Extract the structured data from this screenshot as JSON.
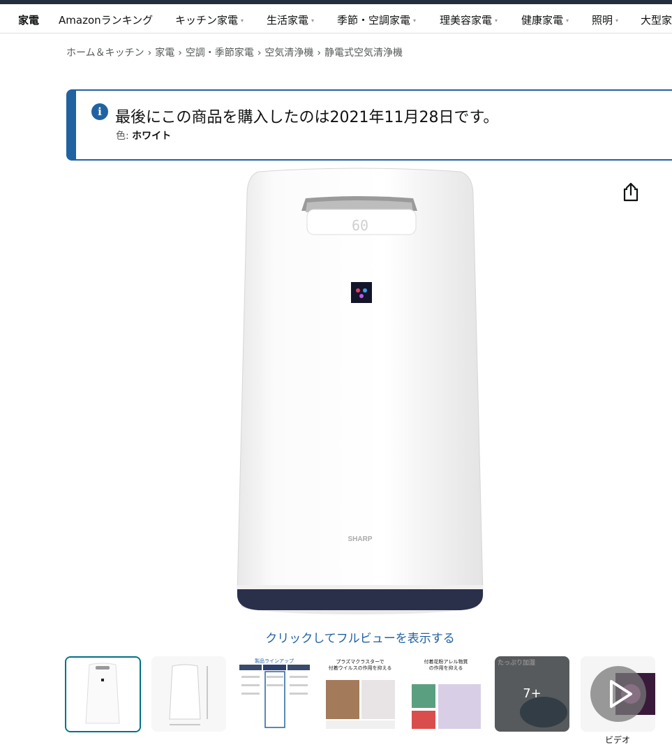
{
  "nav": {
    "items": [
      {
        "label": "家電",
        "dropdown": false
      },
      {
        "label": "Amazonランキング",
        "dropdown": false
      },
      {
        "label": "キッチン家電",
        "dropdown": true
      },
      {
        "label": "生活家電",
        "dropdown": true
      },
      {
        "label": "季節・空調家電",
        "dropdown": true
      },
      {
        "label": "理美容家電",
        "dropdown": true
      },
      {
        "label": "健康家電",
        "dropdown": true
      },
      {
        "label": "照明",
        "dropdown": true
      },
      {
        "label": "大型家",
        "dropdown": false
      }
    ]
  },
  "breadcrumb": {
    "items": [
      "ホーム＆キッチン",
      "家電",
      "空調・季節家電",
      "空気清浄機",
      "静電式空気清浄機"
    ],
    "separator": "›"
  },
  "alert": {
    "icon": "info-icon",
    "title": "最後にこの商品を購入したのは2021年11月28日です。",
    "color_label": "色:",
    "color_value": "ホワイト"
  },
  "product": {
    "brand_text": "SHARP",
    "display_text": "60",
    "fullview_link": "クリックしてフルビューを表示する"
  },
  "thumbnails": {
    "more_label": "7+",
    "video_label": "ビデオ",
    "texts": {
      "t3_title": "製品ラインアップ",
      "t4_title": "プラズマクラスターで",
      "t4_title2": "付着ウイルスの作用を抑える",
      "t5_title": "付着花粉アレル物質",
      "t5_title2": "の作用を抑える",
      "t6_title": "たっぷり加湿"
    }
  },
  "colors": {
    "accent": "#2162a1",
    "selected_border": "#007185",
    "link": "#2162a1",
    "topbar": "#232f3e"
  }
}
